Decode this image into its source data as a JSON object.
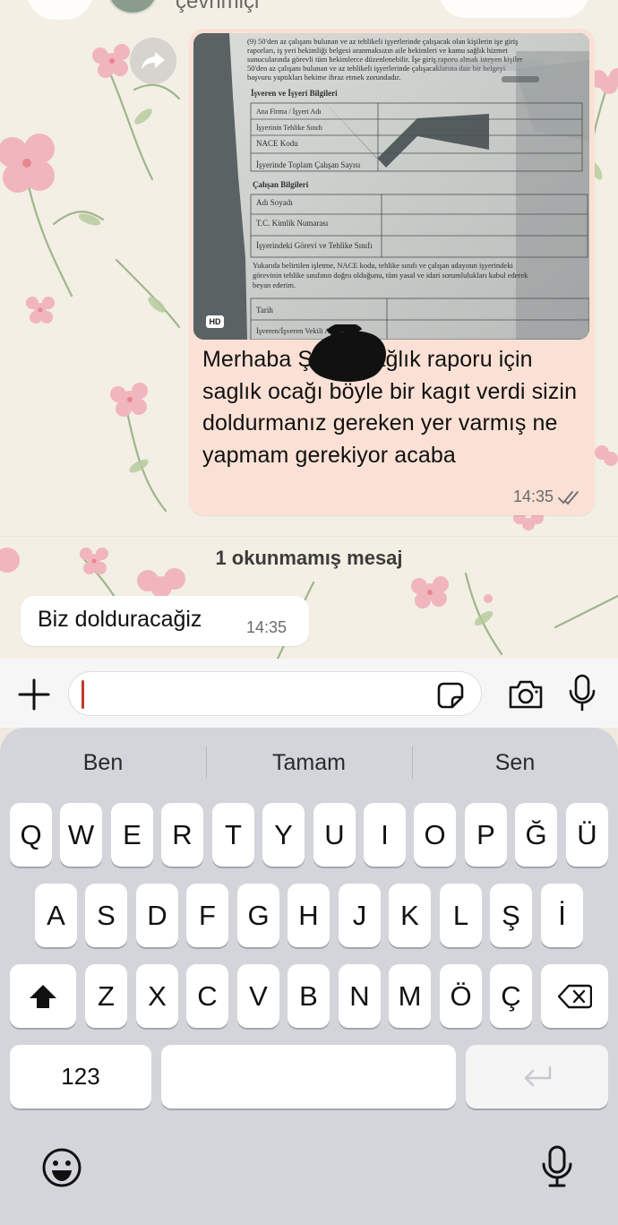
{
  "header": {
    "status_text": "çevrimiçi"
  },
  "message_out": {
    "image_badge": "HD",
    "text": "Merhaba Ş      bey sağlık raporu için saglık ocağı böyle bir kagıt verdi sizin doldurmanız gereken yer varmış ne yapmam gerekiyor acaba",
    "time": "14:35",
    "read_status": "read-double-check-icon"
  },
  "document_photo": {
    "intro_line_1": "(9) 50'den az çalışanı bulunan ve az tehlikeli işyerlerinde çalışacak olan kişilerin işe giriş",
    "intro_line_2": "raporları, iş yeri hekimliği belgesi aranmaksızın aile hekimleri ve kamu sağlık hizmet",
    "intro_line_3": "sunucularında görevli tüm hekimlerce düzenlenebilir. İşe giriş raporu almak isteyen kişiler",
    "intro_line_4": "50'den az çalışanı bulunan ve az tehlikeli işyerlerinde çalışacaklarına dair bir belgeyi",
    "intro_line_5": "başvuru yaptıkları hekime ibraz etmek zorundadır.",
    "section_employer": "İşveren ve İşyeri Bilgileri",
    "rows_employer": [
      "Ana Firma / İşyeri Adı",
      "İşyerinin Tehlike Sınıfı",
      "NACE Kodu",
      "İşyerinde Toplam Çalışan Sayısı"
    ],
    "section_employee": "Çalışan Bilgileri",
    "rows_employee": [
      "Adı Soyadı",
      "T.C. Kimlik Numarası",
      "İşyerindeki Görevi ve Tehlike Sınıfı"
    ],
    "declaration_1": "Yukarıda belirtilen işletme, NACE kodu, tehlike sınıfı ve çalışan adayının işyerindeki",
    "declaration_2": "görevinin tehlike sınıfının doğru olduğunu, tüm yasal ve idari sorumlulukları kabul ederek",
    "declaration_3": "beyan ederim.",
    "rows_sign": [
      "Tarih",
      "İşveren/İşveren Vekili Adı Soyadı"
    ]
  },
  "unread_divider": "1 okunmamış mesaj",
  "message_in": {
    "text": "Biz dolduracağiz",
    "time": "14:35"
  },
  "composer": {
    "placeholder": "",
    "value": ""
  },
  "keyboard": {
    "suggestions": [
      "Ben",
      "Tamam",
      "Sen"
    ],
    "row1": [
      "Q",
      "W",
      "E",
      "R",
      "T",
      "Y",
      "U",
      "I",
      "O",
      "P",
      "Ğ",
      "Ü"
    ],
    "row2": [
      "A",
      "S",
      "D",
      "F",
      "G",
      "H",
      "J",
      "K",
      "L",
      "Ş",
      "İ"
    ],
    "row3": [
      "Z",
      "X",
      "C",
      "V",
      "B",
      "N",
      "M",
      "Ö",
      "Ç"
    ],
    "numbers_key": "123",
    "space_key": "",
    "shift_icon": "shift-icon",
    "delete_icon": "backspace-icon",
    "return_icon": "return-icon",
    "emoji_icon": "emoji-icon",
    "dictation_icon": "microphone-icon"
  },
  "colors": {
    "outgoing_bubble": "#fbe1d5",
    "incoming_bubble": "#ffffff",
    "wallpaper": "#f3efe4",
    "keyboard_bg": "#d3d5da"
  }
}
